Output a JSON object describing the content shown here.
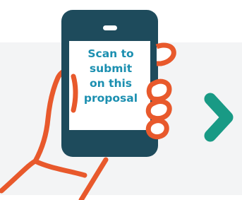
{
  "prompt": {
    "lines": [
      "Scan to",
      "submit",
      "on this",
      "proposal"
    ]
  },
  "colors": {
    "phone": "#1e4b5c",
    "screen": "#ffffff",
    "hand_outline": "#e8592c",
    "text": "#1b8fb0",
    "arrow": "#199a85",
    "panel": "#f3f4f5"
  },
  "icons": {
    "phone": "smartphone-icon",
    "hand": "hand-icon",
    "next": "chevron-right-icon"
  }
}
